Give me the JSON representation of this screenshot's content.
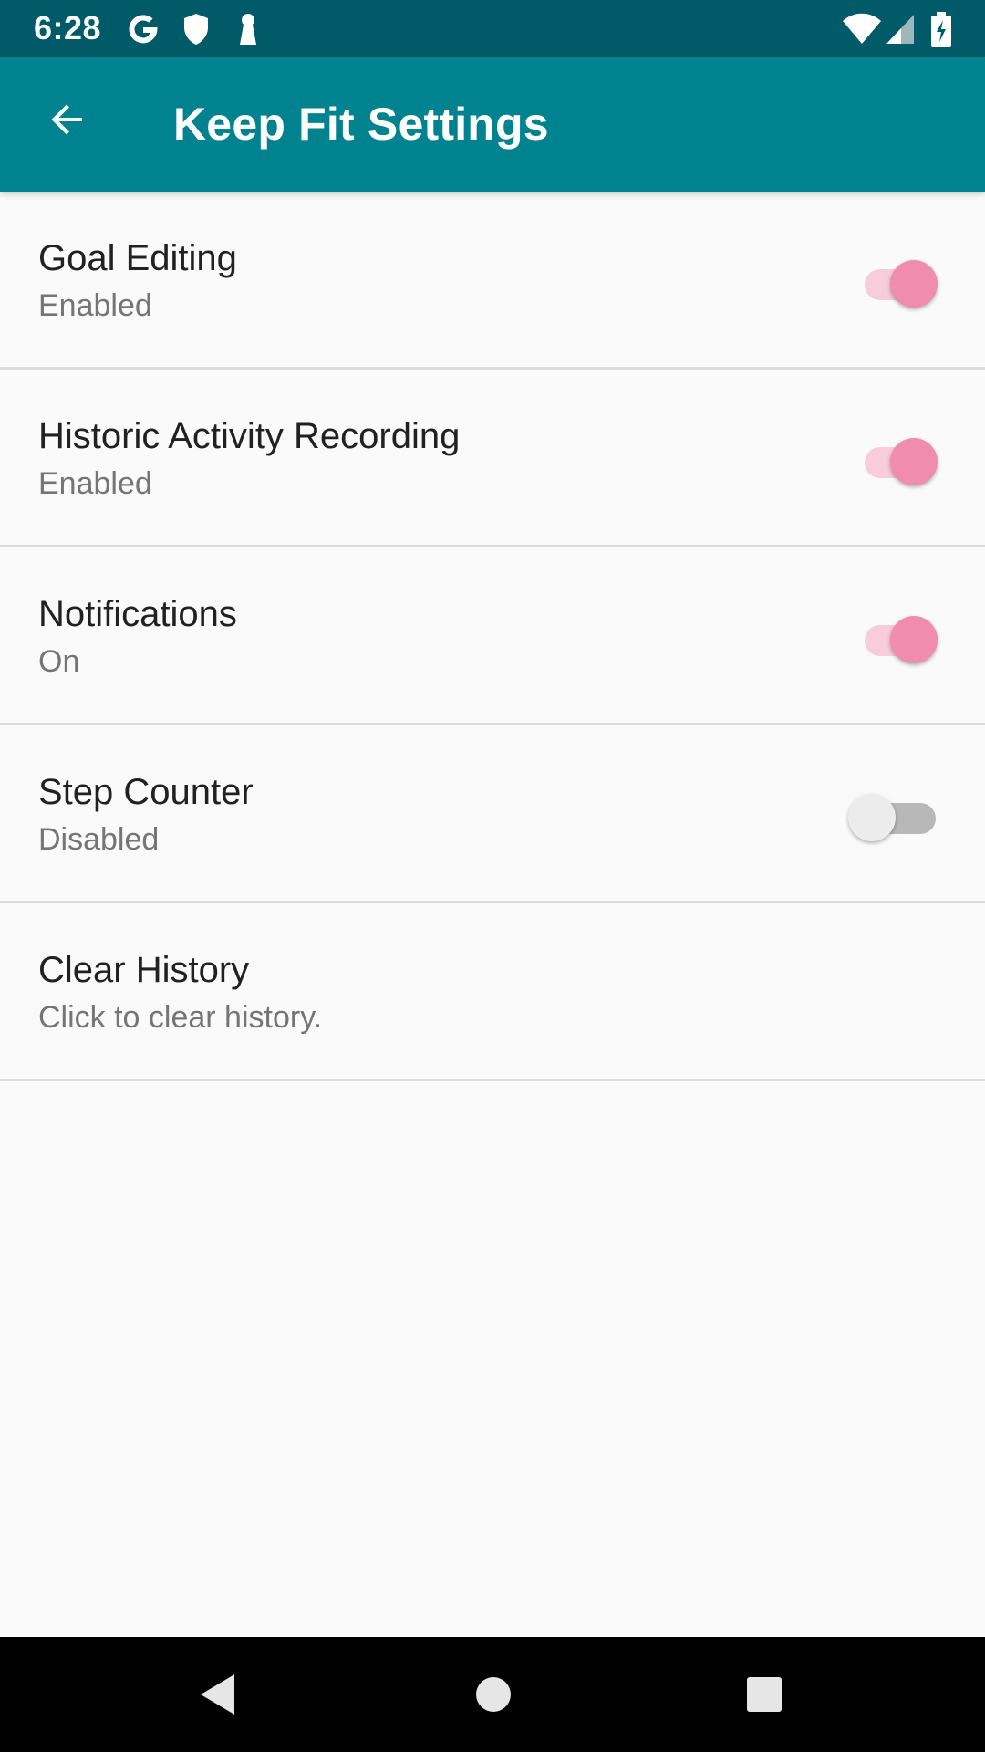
{
  "status_bar": {
    "time": "6:28",
    "left_icons": [
      "google-icon",
      "shield-icon",
      "keyhole-icon"
    ],
    "right_icons": [
      "wifi-icon",
      "cell-signal-icon",
      "battery-charging-icon"
    ]
  },
  "app_bar": {
    "title": "Keep Fit Settings",
    "back_icon": "arrow-back-icon",
    "color": "#00838f",
    "status_color": "#005a68"
  },
  "settings": [
    {
      "title": "Goal Editing",
      "summary": "Enabled",
      "toggle": true
    },
    {
      "title": "Historic Activity Recording",
      "summary": "Enabled",
      "toggle": true
    },
    {
      "title": "Notifications",
      "summary": "On",
      "toggle": true
    },
    {
      "title": "Step Counter",
      "summary": "Disabled",
      "toggle": false
    },
    {
      "title": "Clear History",
      "summary": "Click to clear history."
    }
  ],
  "colors": {
    "toggle_on_thumb": "#f08cad",
    "toggle_on_track": "#f7ccdb",
    "toggle_off_thumb": "#ececec",
    "toggle_off_track": "#b8b8b8"
  },
  "nav_bar": {
    "icons": [
      "nav-back-icon",
      "nav-home-icon",
      "nav-recents-icon"
    ]
  }
}
